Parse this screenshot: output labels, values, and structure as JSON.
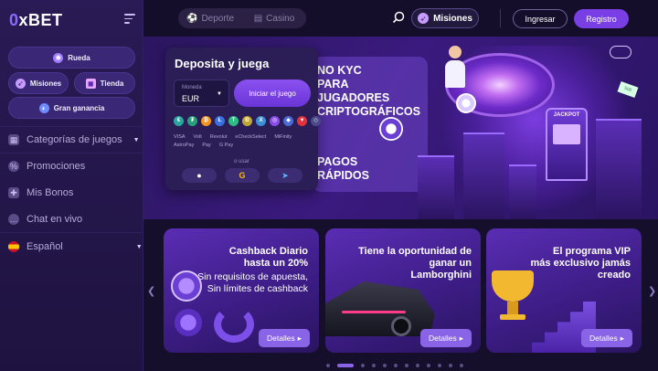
{
  "brand": {
    "logo_prefix": "0",
    "logo_rest": "xBET"
  },
  "sidebar": {
    "pills": [
      {
        "label": "Rueda",
        "icon": "wheel-icon"
      },
      {
        "label": "Misiones",
        "icon": "rocket-icon"
      },
      {
        "label": "Tienda",
        "icon": "gift-box-icon"
      },
      {
        "label": "Gran ganancia",
        "icon": "planet-icon"
      }
    ],
    "nav": [
      {
        "label": "Categorías de juegos",
        "icon": "grid-icon"
      },
      {
        "label": "Promociones",
        "icon": "percent-icon"
      },
      {
        "label": "Mis Bonos",
        "icon": "gift-icon"
      },
      {
        "label": "Chat en vivo",
        "icon": "chat-icon"
      },
      {
        "label": "Español",
        "icon": "spain-flag-icon"
      }
    ]
  },
  "topbar": {
    "tabs": [
      {
        "label": "Deporte"
      },
      {
        "label": "Casino"
      }
    ],
    "misiones": "Misiones",
    "login": "Ingresar",
    "register": "Registro"
  },
  "deposit": {
    "title": "Deposita y juega",
    "currency_label": "Moneda",
    "currency_value": "EUR",
    "play_button": "Iniciar el juego",
    "or_use": "o usar",
    "coins": [
      "€",
      "₮",
      "₿",
      "Ł",
      "T",
      "Ð",
      "X",
      "◎",
      "◆",
      "▼",
      "◇"
    ],
    "payments": [
      "VISA",
      "Volt",
      "Revolut",
      "eCheckSelect",
      "MiFinity",
      "AstroPay",
      "Pay",
      "G Pay"
    ]
  },
  "hero": {
    "line1": "NO KYC\nPARA\nJUGADORES\nCRIPTOGRÁFICOS",
    "line2": "PAGOS\nRÁPIDOS",
    "bill_text": "500",
    "slot_label": "JACKPOT"
  },
  "cards": [
    {
      "title": "Cashback Diario\nhasta un 20%",
      "sub": "Sin requisitos de apuesta,\nSin límites de cashback",
      "button": "Detalles"
    },
    {
      "title": "Tiene la oportunidad de\nganar un\nLamborghini",
      "sub": "",
      "button": "Detalles"
    },
    {
      "title": "El programa VIP\nmás exclusivo jamás\ncreado",
      "sub": "",
      "button": "Detalles"
    }
  ],
  "colors": {
    "accent": "#7a3fe4",
    "bg": "#160f2c",
    "sidebar": "#2a1a55",
    "button": "#8a64e6"
  }
}
